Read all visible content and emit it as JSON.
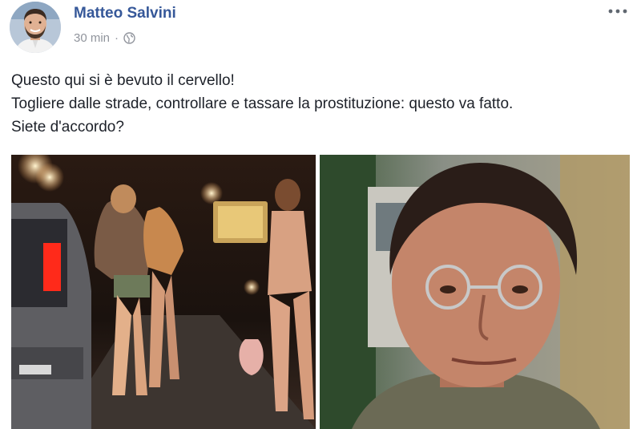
{
  "post": {
    "author": "Matteo Salvini",
    "timestamp": "30 min",
    "separator": "·",
    "privacy_icon": "globe-icon",
    "more_icon": "more-options-icon",
    "text_lines": [
      "Questo qui si è bevuto il cervello!",
      "Togliere dalle strade, controllare e tassare la prostituzione: questo va fatto.",
      "Siete d'accordo?"
    ]
  },
  "colors": {
    "author_link": "#365899",
    "meta_gray": "#90949c",
    "body_text": "#1d2129"
  }
}
